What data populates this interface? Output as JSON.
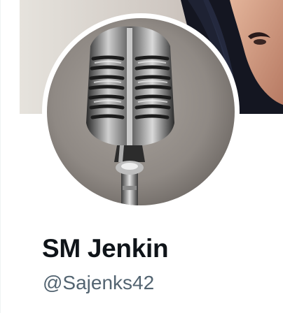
{
  "profile": {
    "display_name": "SM Jenkin",
    "handle": "@Sajenks42",
    "avatar_subject": "microphone-icon",
    "banner_subject": "portrait-photo"
  },
  "colors": {
    "name_text": "#0f1419",
    "handle_text": "#536471",
    "avatar_border": "#ffffff",
    "divider": "#eff3f4"
  }
}
